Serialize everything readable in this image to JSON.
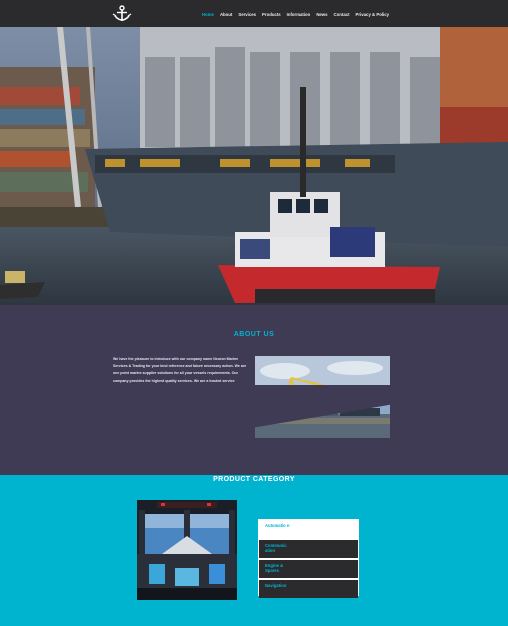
{
  "nav": {
    "logo_icon": "anchor-icon",
    "items": [
      {
        "label": "Home",
        "active": true
      },
      {
        "label": "About"
      },
      {
        "label": "Services"
      },
      {
        "label": "Products"
      },
      {
        "label": "Information"
      },
      {
        "label": "News"
      },
      {
        "label": "Contact"
      },
      {
        "label": "Privacy & Policy"
      }
    ]
  },
  "hero": {
    "image": "container-ship-and-tugboat-at-port"
  },
  "about": {
    "title": "ABOUT US",
    "text": "We have the pleasure to introduce with our company name Neuron Marine Services & Trading for your kind reference and future necessary action. We are one point marine supplier solutions for all your vessels requirements. Our company provides the highest quality services. We are a trusted service provider for over a decade with our efforts and our client's satisfaction. We focus carefully and understand the needs of our clients. We have been committed to setting the highest standards for quality and client service within the given period of time whatever your vessels needs, we can help. Neuron Marine Services & Trading started its journey with a unique ambition of providing one point marine supplier solutions for all marine vessels related requirements across the globe.",
    "image": "port-cranes-and-cargo-ships"
  },
  "products": {
    "title": "PRODUCT CATEGORY",
    "image": "ship-bridge-navigation-console",
    "categories": [
      "Automatio n",
      "Communic ation",
      "Engine & Spares",
      "Navigation"
    ]
  },
  "colors": {
    "accent": "#00b4cf",
    "nav_bg": "#2b2b2e",
    "about_bg": "#3f3b54"
  }
}
